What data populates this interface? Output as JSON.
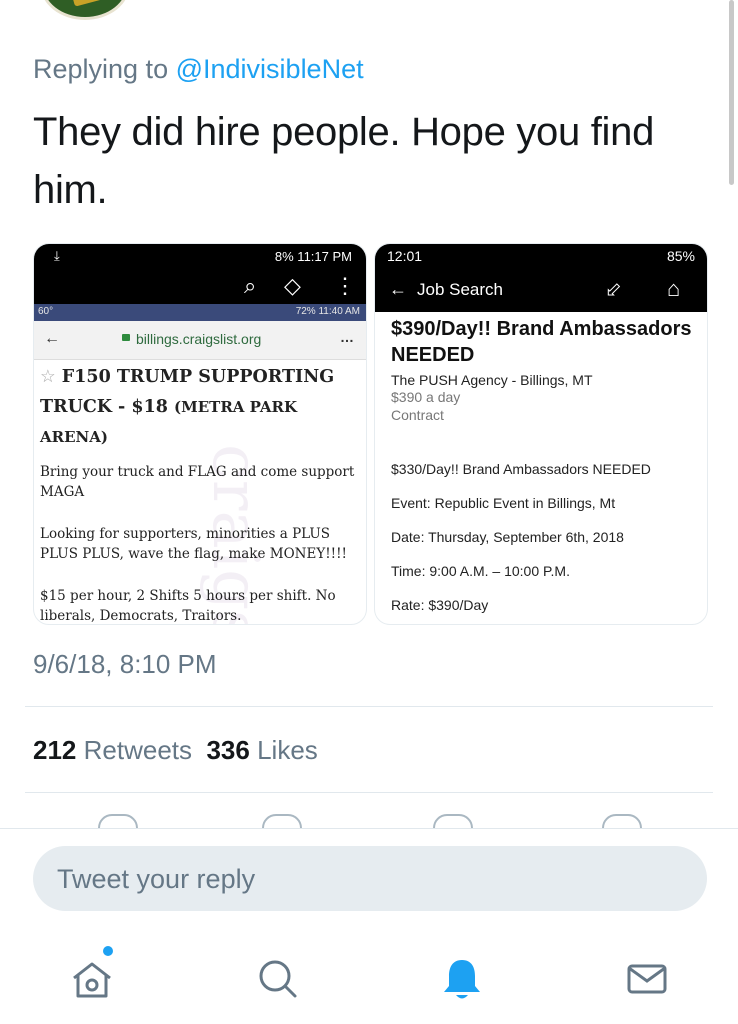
{
  "tweet": {
    "replying_prefix": "Replying to",
    "replying_handle": "@IndivisibleNet",
    "text": "They did hire people. Hope you find him.",
    "timestamp": "9/6/18, 8:10 PM",
    "retweets_count": "212",
    "retweets_label": "Retweets",
    "likes_count": "336",
    "likes_label": "Likes"
  },
  "left_image": {
    "status_right": "8% 11:17 PM",
    "inner_status_left": "60°",
    "inner_status_right": "72% 11:40 AM",
    "url": "billings.craigslist.org",
    "title_main": "F150 TRUMP SUPPORTING TRUCK - $18",
    "title_location": "(METRA PARK ARENA)",
    "para1": "Bring your truck and FLAG and come support MAGA",
    "para2": "Looking for supporters, minorities a PLUS PLUS PLUS, wave the flag, make MONEY!!!!",
    "para3": "$15 per hour, 2 Shifts 5 hours per shift. No liberals, Democrats, Traitors.",
    "watermark": "craigslist"
  },
  "right_image": {
    "status_time": "12:01",
    "status_battery": "85%",
    "toolbar_title": "Job Search",
    "job_title": "$390/Day!! Brand Ambassadors NEEDED",
    "company": "The PUSH Agency - Billings, MT",
    "pay": "$390 a day",
    "type": "Contract",
    "line1": "$330/Day!! Brand Ambassadors NEEDED",
    "line2": "Event: Republic Event in Billings, Mt",
    "line3": "Date: Thursday, September 6th, 2018",
    "line4": "Time: 9:00 A.M. – 10:00 P.M.",
    "line5": "Rate: $390/Day"
  },
  "reply_box": {
    "placeholder": "Tweet your reply"
  },
  "tabbar": {
    "items": [
      "home-icon",
      "search-icon",
      "notifications-icon",
      "messages-icon"
    ],
    "active": "notifications-icon",
    "accent": "#1da1f2"
  },
  "colors": {
    "link": "#1da1f2",
    "secondary_text": "#657786",
    "primary_text": "#14171a"
  }
}
